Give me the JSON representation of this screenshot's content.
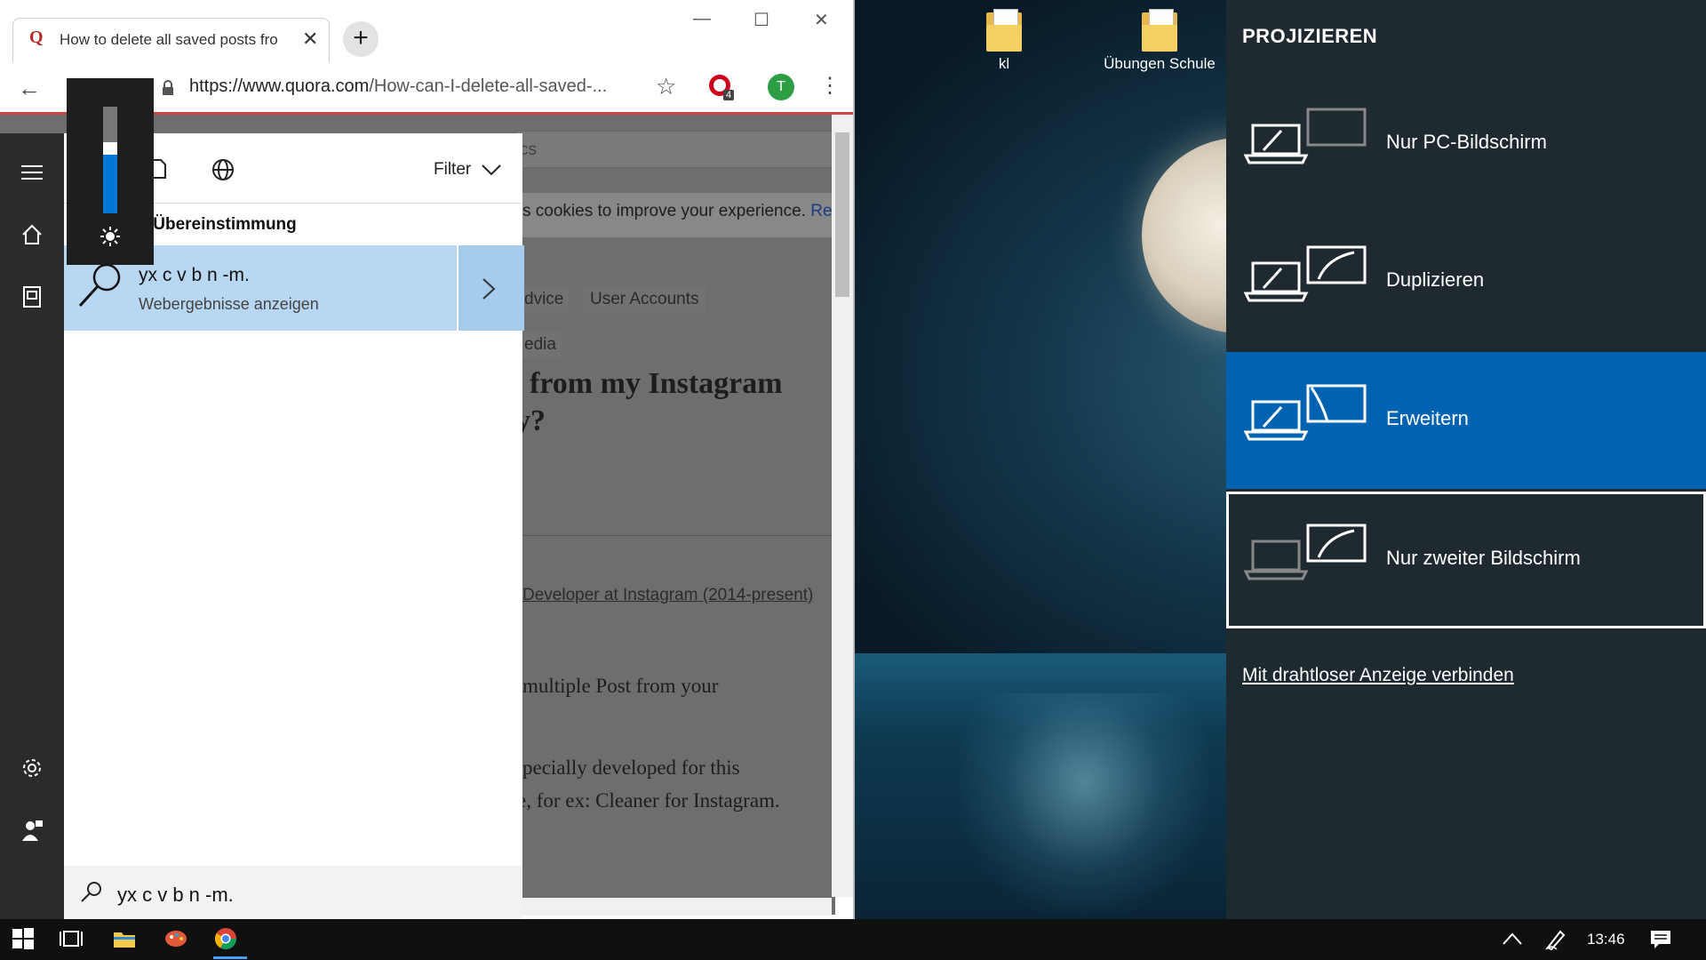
{
  "browser": {
    "tab_title": "How to delete all saved posts fro",
    "tab_favicon": "Q",
    "url_domain": "https://www.quora.com",
    "url_rest": "/How-can-I-delete-all-saved-...",
    "extension_badge": "4",
    "profile_initial": "T"
  },
  "page": {
    "search_hint": "cs",
    "cookie_text": "s cookies to improve your experience.",
    "cookie_link": "Re",
    "topic_1": "dvice",
    "topic_2": "User Accounts",
    "topic_3": "edia",
    "heading_1": "from my Instagram",
    "heading_2": "y?",
    "author_cred": "Developer at Instagram (2014-present)",
    "para_1": "multiple Post from your",
    "para_2": "pecially developed for this",
    "para_3": "e, for ex: Cleaner for Instagram."
  },
  "search": {
    "filter_label": "Filter",
    "best_match_label": "Höchste Übereinstimmung",
    "result_query": "yx c v b n -m.",
    "result_sub": "Webergebnisse anzeigen",
    "query": "yx c v b n -m."
  },
  "brightness": {
    "level": 0.55
  },
  "desktop": {
    "icons": [
      {
        "label": "kl"
      },
      {
        "label": "Übungen Schule"
      }
    ]
  },
  "project": {
    "title": "PROJIZIEREN",
    "options": [
      {
        "label": "Nur PC-Bildschirm",
        "selected": false
      },
      {
        "label": "Duplizieren",
        "selected": false
      },
      {
        "label": "Erweitern",
        "selected": true
      },
      {
        "label": "Nur zweiter Bildschirm",
        "selected": false
      }
    ],
    "wireless_link": "Mit drahtloser Anzeige verbinden",
    "selected_color": "#0063b1"
  },
  "taskbar": {
    "clock": "13:46"
  },
  "colors": {
    "accent": "#0078d7",
    "result_bg": "#b8d7f2",
    "quora_red": "#b92b27",
    "profile_green": "#2e9e44"
  }
}
